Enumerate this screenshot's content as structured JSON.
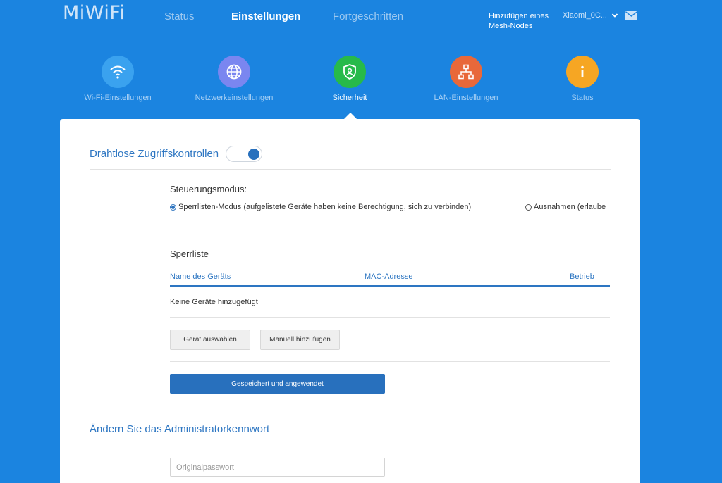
{
  "header": {
    "logo": "MiWiFi",
    "nav": [
      {
        "label": "Status",
        "active": false
      },
      {
        "label": "Einstellungen",
        "active": true
      },
      {
        "label": "Fortgeschritten",
        "active": false
      }
    ],
    "mesh_link": "Hinzufügen eines Mesh-Nodes",
    "device": "Xiaomi_0C...",
    "icons": {
      "device_chevron": "chevron-down-icon",
      "mail": "mail-icon"
    }
  },
  "categories": [
    {
      "label": "Wi-Fi-Einstellungen",
      "icon": "wifi-icon",
      "color": "#3aa2ef",
      "active": false
    },
    {
      "label": "Netzwerkeinstellungen",
      "icon": "globe-icon",
      "color": "#7a86f0",
      "active": false
    },
    {
      "label": "Sicherheit",
      "icon": "shield-icon",
      "color": "#27ba4a",
      "active": true
    },
    {
      "label": "LAN-Einstellungen",
      "icon": "network-icon",
      "color": "#e8683a",
      "active": false
    },
    {
      "label": "Status",
      "icon": "info-icon",
      "color": "#f6a623",
      "active": false
    }
  ],
  "access_control": {
    "title": "Drahtlose Zugriffskontrollen",
    "enabled": true,
    "mode_label": "Steuerungsmodus:",
    "mode_blacklist": "Sperrlisten-Modus (aufgelistete Geräte haben keine Berechtigung, sich zu verbinden)",
    "mode_whitelist": "Ausnahmen (erlaube diesen Geräten, sich mit dem Netzwerk zu verbinden)",
    "selected_mode": "blacklist",
    "list_title": "Sperrliste",
    "columns": [
      "Name des Geräts",
      "MAC-Adresse",
      "Betrieb"
    ],
    "empty_text": "Keine Geräte hinzugefügt",
    "select_device_button": "Gerät auswählen",
    "manual_add_button": "Manuell hinzufügen",
    "save_button": "Gespeichert und angewendet"
  },
  "admin_password": {
    "title": "Ändern Sie das Administratorkennwort",
    "original_placeholder": "Originalpasswort"
  },
  "colors": {
    "background": "#1b84e0",
    "accent": "#2870bd",
    "heading": "#2d76c2"
  }
}
